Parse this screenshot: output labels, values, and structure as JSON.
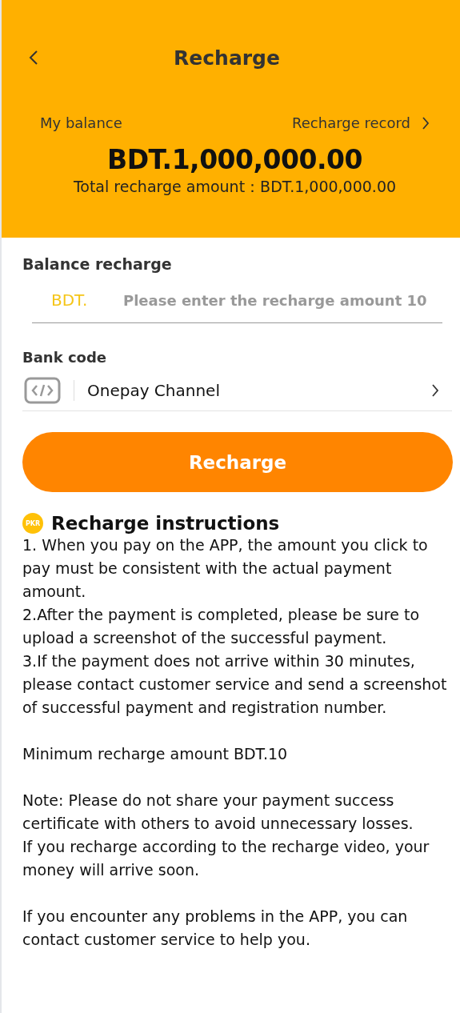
{
  "header": {
    "title": "Recharge",
    "balance_label": "My balance",
    "record_link": "Recharge record",
    "balance": "BDT.1,000,000.00",
    "total_label": "Total recharge amount：BDT.1,000,000.00"
  },
  "recharge": {
    "heading": "Balance recharge",
    "currency": "BDT.",
    "placeholder": "Please enter the recharge amount 10"
  },
  "bank": {
    "heading": "Bank code",
    "channel": "Onepay Channel"
  },
  "submit": "Recharge",
  "instructions": {
    "coin_label": "PKR",
    "title": "Recharge instructions",
    "paragraphs": [
      [
        "1. When you pay on the APP, the amount you click to pay must be consistent with the actual payment amount.",
        "2.After the payment is completed, please be sure to upload a screenshot of the successful payment.",
        "3.If the payment does not arrive within 30 minutes, please contact customer service and send a screenshot of successful payment and registration number."
      ],
      [
        "Minimum recharge amount BDT.10"
      ],
      [
        "Note: Please do not share your payment success certificate with others to avoid unnecessary losses.",
        "If you recharge according to the recharge video, your money will arrive soon."
      ],
      [
        "If you encounter any problems in the APP, you can contact customer service to help you."
      ]
    ]
  }
}
